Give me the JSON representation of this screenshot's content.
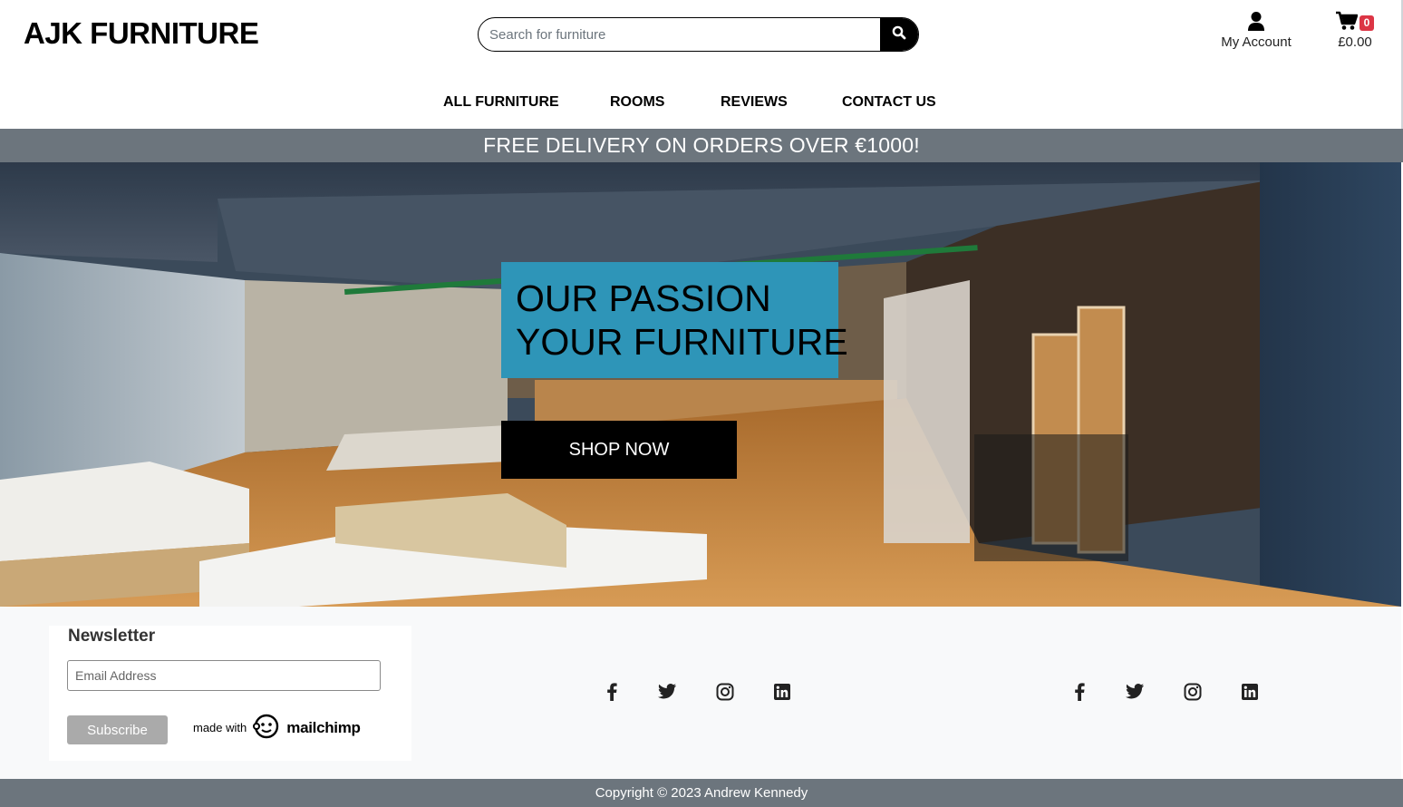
{
  "header": {
    "logo": "AJK FURNITURE",
    "search_placeholder": "Search for furniture",
    "account_label": "My Account",
    "cart_total": "£0.00",
    "cart_count": "0"
  },
  "nav": {
    "items": [
      "ALL FURNITURE",
      "ROOMS",
      "REVIEWS",
      "CONTACT US"
    ]
  },
  "banner": "FREE DELIVERY ON ORDERS OVER €1000!",
  "hero": {
    "title_line1": "OUR PASSION",
    "title_line2": "YOUR FURNITURE",
    "cta": "SHOP NOW"
  },
  "newsletter": {
    "title": "Newsletter",
    "email_placeholder": "Email Address",
    "subscribe": "Subscribe",
    "made_with": "made with",
    "brand": "mailchimp"
  },
  "social_groups": [
    [
      "facebook-icon",
      "twitter-icon",
      "instagram-icon",
      "linkedin-icon"
    ],
    [
      "facebook-icon",
      "twitter-icon",
      "instagram-icon",
      "linkedin-icon"
    ]
  ],
  "copyright": "Copyright © 2023 Andrew Kennedy",
  "colors": {
    "hero_title_bg": "#2e95b8",
    "banner_bg": "#6c757d",
    "badge": "#dc3545"
  }
}
